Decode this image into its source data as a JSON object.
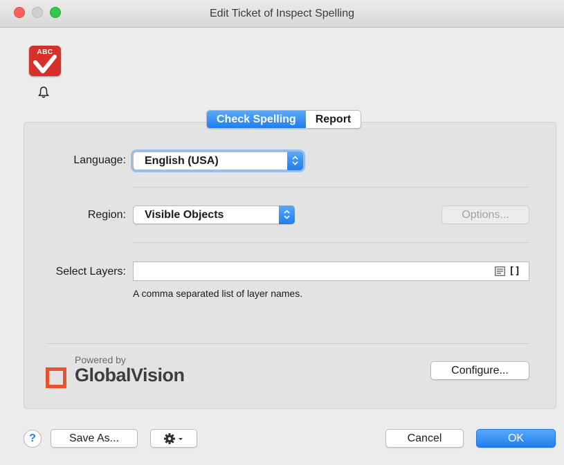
{
  "window": {
    "title": "Edit Ticket of Inspect Spelling"
  },
  "app": {
    "icon_text": "ABC",
    "icon": "spellcheck-icon",
    "notification_icon": "bell-icon"
  },
  "tabs": [
    {
      "label": "Check Spelling",
      "active": true
    },
    {
      "label": "Report",
      "active": false
    }
  ],
  "form": {
    "language": {
      "label": "Language:",
      "value": "English (USA)"
    },
    "region": {
      "label": "Region:",
      "value": "Visible Objects"
    },
    "options_button": "Options...",
    "layers": {
      "label": "Select Layers:",
      "value": "",
      "hint": "A comma separated list of layer names.",
      "list_icon": "list-icon",
      "brackets": "[]"
    }
  },
  "branding": {
    "powered_by": "Powered by",
    "name": "GlobalVision",
    "accent": "#e8532f"
  },
  "configure_button": "Configure...",
  "footer": {
    "help": "?",
    "save_as": "Save As...",
    "gear_icon": "gear-icon",
    "cancel": "Cancel",
    "ok": "OK"
  },
  "colors": {
    "accent": "#1f7ef0"
  }
}
